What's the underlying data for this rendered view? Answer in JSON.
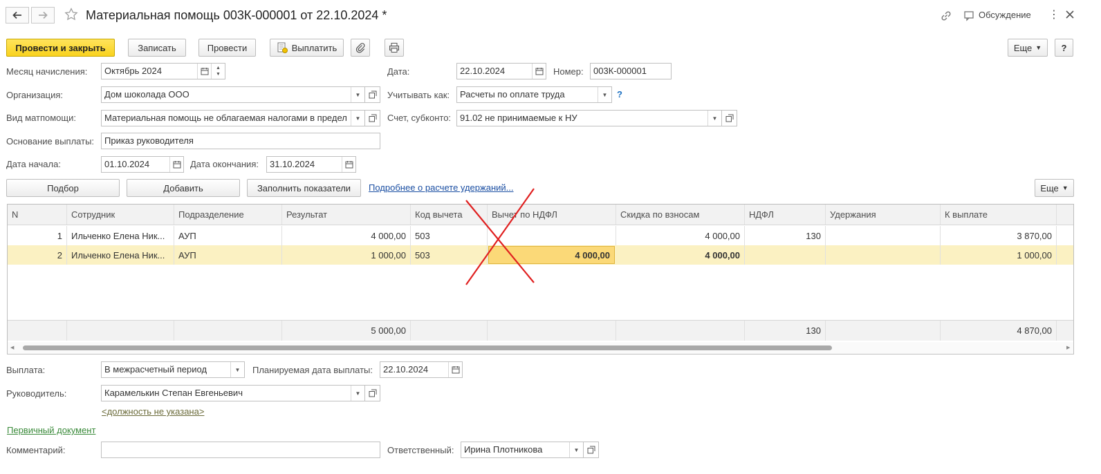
{
  "window": {
    "title": "Материальная помощь 003К-000001 от 22.10.2024 *",
    "discussion_label": "Обсуждение"
  },
  "toolbar": {
    "post_close": "Провести и закрыть",
    "save": "Записать",
    "post": "Провести",
    "pay": "Выплатить",
    "more": "Еще",
    "help": "?"
  },
  "form": {
    "month_label": "Месяц начисления:",
    "month_value": "Октябрь 2024",
    "date_label": "Дата:",
    "date_value": "22.10.2024",
    "number_label": "Номер:",
    "number_value": "003К-000001",
    "org_label": "Организация:",
    "org_value": "Дом шоколада ООО",
    "account_as_label": "Учитывать как:",
    "account_as_value": "Расчеты по оплате труда",
    "account_as_help": "?",
    "aid_type_label": "Вид матпомощи:",
    "aid_type_value": "Материальная помощь не облагаемая налогами в предел",
    "account_label": "Счет, субконто:",
    "account_value": "91.02 не принимаемые к НУ",
    "basis_label": "Основание выплаты:",
    "basis_value": "Приказ руководителя",
    "start_label": "Дата начала:",
    "start_value": "01.10.2024",
    "end_label": "Дата окончания:",
    "end_value": "31.10.2024"
  },
  "table_toolbar": {
    "pick": "Подбор",
    "add": "Добавить",
    "fill": "Заполнить показатели",
    "details_link": "Подробнее о расчете удержаний...",
    "more": "Еще"
  },
  "table": {
    "columns": [
      "N",
      "Сотрудник",
      "Подразделение",
      "Результат",
      "Код вычета",
      "Вычет по НДФЛ",
      "Скидка по взносам",
      "НДФЛ",
      "Удержания",
      "К выплате"
    ],
    "rows": [
      [
        "1",
        "Ильченко Елена Ник...",
        "АУП",
        "4 000,00",
        "503",
        "",
        "4 000,00",
        "130",
        "",
        "3 870,00"
      ],
      [
        "2",
        "Ильченко Елена Ник...",
        "АУП",
        "1 000,00",
        "503",
        "4 000,00",
        "4 000,00",
        "",
        "",
        "1 000,00"
      ]
    ],
    "totals": [
      "",
      "",
      "",
      "5 000,00",
      "",
      "",
      "",
      "130",
      "",
      "4 870,00"
    ]
  },
  "payment": {
    "payout_label": "Выплата:",
    "payout_value": "В межрасчетный период",
    "planned_label": "Планируемая дата выплаты:",
    "planned_value": "22.10.2024",
    "manager_label": "Руководитель:",
    "manager_value": "Карамелькин Степан Евгеньевич",
    "position_link": "<должность не указана>",
    "primary_doc_link": "Первичный документ",
    "comment_label": "Комментарий:",
    "comment_value": "",
    "responsible_label": "Ответственный:",
    "responsible_value": "Ирина Плотникова"
  },
  "colors": {
    "primary_button": "#f9d21e",
    "selected_row": "#fbf1c2",
    "active_cell": "#fbd978",
    "link_blue": "#1a4ea2",
    "link_green": "#3a8a3a",
    "annotation_red": "#e02020"
  }
}
